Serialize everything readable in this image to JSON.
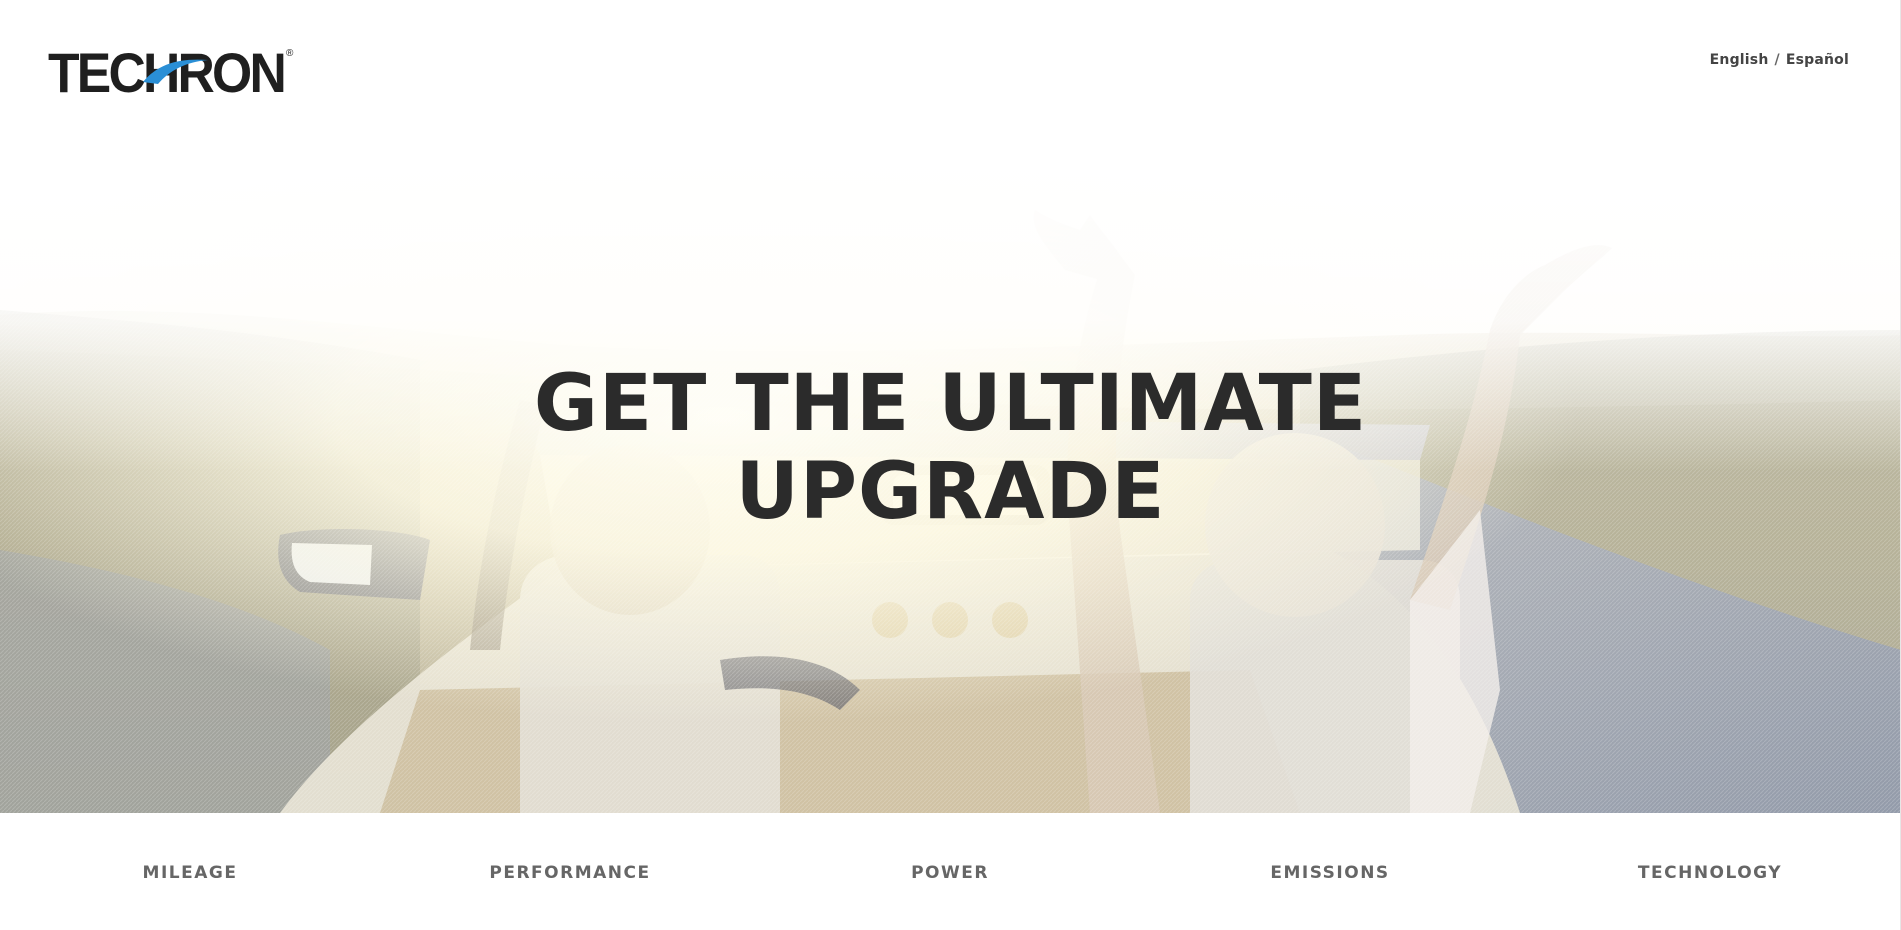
{
  "header": {
    "logo_text": "TECHRON",
    "logo_mark": "®",
    "languages": [
      "English",
      "Español"
    ],
    "language_separator": "/"
  },
  "hero": {
    "title_line_1": "GET THE ULTIMATE",
    "title_line_2": "UPGRADE"
  },
  "feature_nav": {
    "items": [
      "MILEAGE",
      "PERFORMANCE",
      "POWER",
      "EMISSIONS",
      "TECHNOLOGY"
    ]
  },
  "colors": {
    "title_text": "#2b2b2b",
    "nav_text": "#666666",
    "logo_dark": "#1f1f1f",
    "logo_swoosh": "#2a8fd6",
    "sky": "#fdfaf0"
  },
  "icons": {
    "logo": "techron-logo",
    "hero_image": "convertible-couple-photo"
  }
}
